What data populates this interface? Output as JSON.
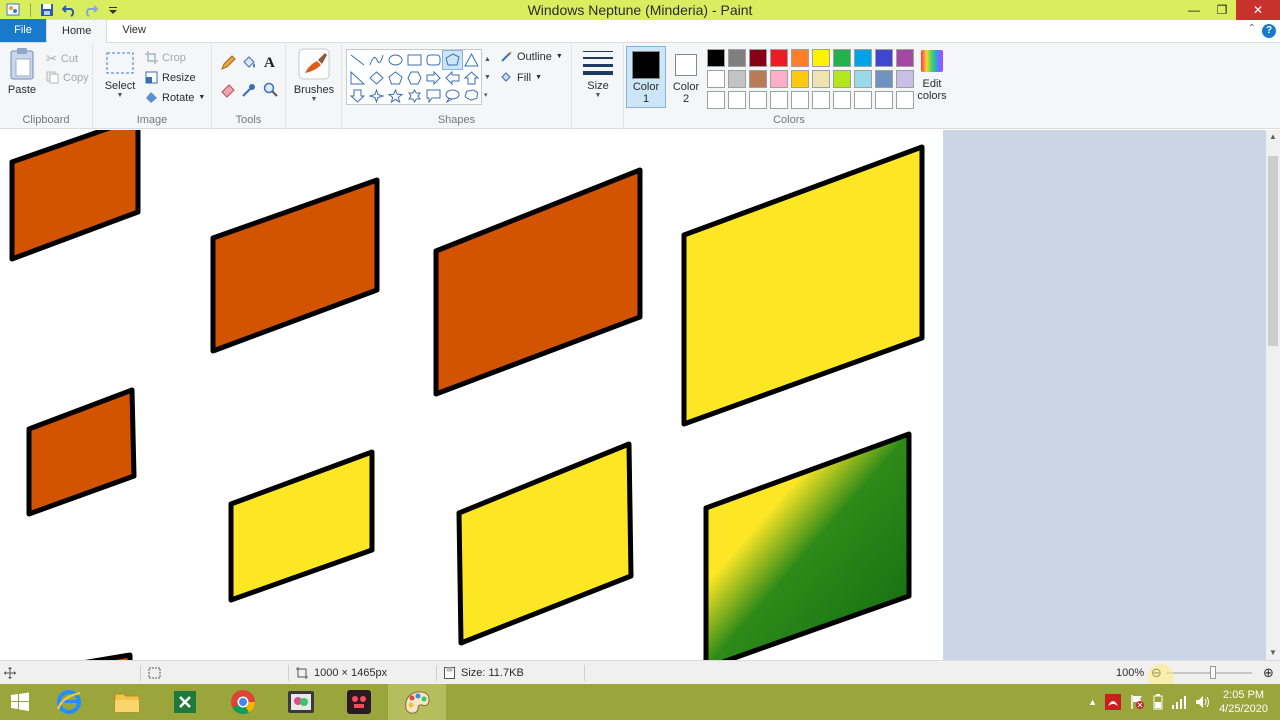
{
  "window": {
    "title": "Windows Neptune (Minderia) - Paint",
    "controls": {
      "minimize": "minimize-icon",
      "restore": "restore-icon",
      "close": "close-icon"
    }
  },
  "quick_access": [
    "save-icon",
    "undo-icon",
    "redo-icon",
    "customize-icon"
  ],
  "tabs": [
    {
      "label": "File"
    },
    {
      "label": "Home"
    },
    {
      "label": "View"
    }
  ],
  "ribbon": {
    "clipboard": {
      "group": "Clipboard",
      "paste": "Paste",
      "cut": "Cut",
      "copy": "Copy"
    },
    "image": {
      "group": "Image",
      "select": "Select",
      "crop": "Crop",
      "resize": "Resize",
      "rotate": "Rotate"
    },
    "tools": {
      "group": "Tools"
    },
    "brushes": {
      "label": "Brushes"
    },
    "shapes": {
      "group": "Shapes",
      "outline": "Outline",
      "fill": "Fill"
    },
    "size": {
      "label": "Size"
    },
    "colors": {
      "group": "Colors",
      "color1_line1": "Color",
      "color1_line2": "1",
      "color2_line1": "Color",
      "color2_line2": "2",
      "edit_line1": "Edit",
      "edit_line2": "colors",
      "color1_value": "#000000",
      "color2_value": "#ffffff",
      "palette": [
        "#000000",
        "#7f7f7f",
        "#880015",
        "#ed1c24",
        "#ff7f27",
        "#fff200",
        "#22b14c",
        "#00a2e8",
        "#3f48cc",
        "#a349a4",
        "#ffffff",
        "#c3c3c3",
        "#b97a57",
        "#ffaec9",
        "#ffc90e",
        "#efe4b0",
        "#b5e61d",
        "#99d9ea",
        "#7092be",
        "#c8bfe7",
        "#ffffff",
        "#ffffff",
        "#ffffff",
        "#ffffff",
        "#ffffff",
        "#ffffff",
        "#ffffff",
        "#ffffff",
        "#ffffff",
        "#ffffff"
      ]
    }
  },
  "canvas_colors": {
    "orange": "#d35400",
    "yellow": "#fde725",
    "green": "#0d6b12",
    "outline": "#000000"
  },
  "status": {
    "dimensions": "1000 × 1465px",
    "size": "Size: 11.7KB",
    "zoom": "100%"
  },
  "taskbar": {
    "apps": [
      "start-icon",
      "internet-explorer-icon",
      "file-explorer-icon",
      "excel-icon",
      "chrome-icon",
      "photo-app-icon",
      "media-app-icon",
      "paint-icon"
    ],
    "clock_time": "2:05 PM",
    "clock_date": "4/25/2020"
  }
}
